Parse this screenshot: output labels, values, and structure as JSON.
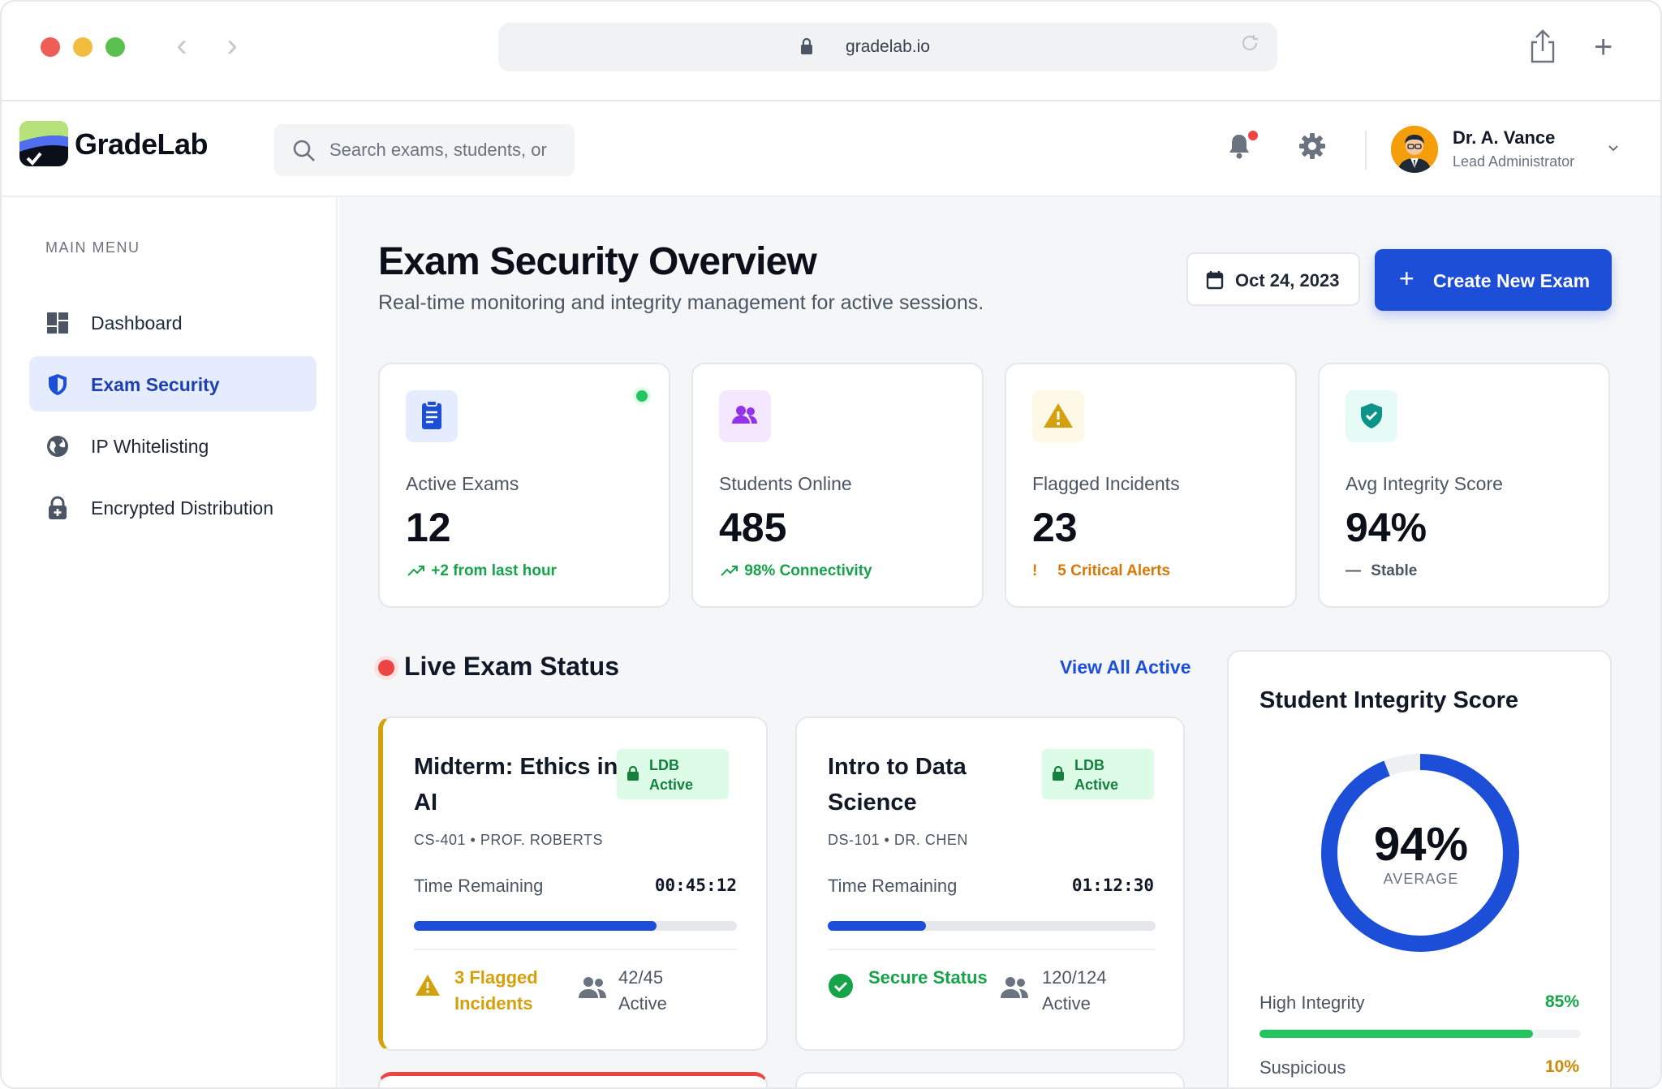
{
  "browser": {
    "url": "gradelab.io"
  },
  "header": {
    "brand": "GradeLab",
    "search_placeholder": "Search exams, students, or",
    "user_name": "Dr. A. Vance",
    "user_role": "Lead Administrator"
  },
  "sidebar": {
    "section_label": "MAIN MENU",
    "items": [
      {
        "label": "Dashboard",
        "icon": "dashboard-icon",
        "active": false
      },
      {
        "label": "Exam Security",
        "icon": "shield-icon",
        "active": true
      },
      {
        "label": "IP Whitelisting",
        "icon": "globe-icon",
        "active": false
      },
      {
        "label": "Encrypted Distribution",
        "icon": "lock-plus-icon",
        "active": false
      }
    ]
  },
  "main": {
    "title": "Exam Security Overview",
    "subtitle": "Real-time monitoring and integrity management for active sessions.",
    "date": "Oct 24, 2023",
    "create_label": "Create New Exam"
  },
  "stats": [
    {
      "label": "Active Exams",
      "value": "12",
      "trend": "+2 from last hour",
      "trend_color": "#16a34a",
      "icon": "clipboard-icon",
      "icon_color": "#1d4ed8",
      "icon_bg": "#e5ecfd"
    },
    {
      "label": "Students Online",
      "value": "485",
      "trend": "98% Connectivity",
      "trend_color": "#16a34a",
      "icon": "users-icon",
      "icon_color": "#9333ea",
      "icon_bg": "#f3e8ff"
    },
    {
      "label": "Flagged Incidents",
      "value": "23",
      "trend": "5 Critical Alerts",
      "trend_color": "#d97706",
      "icon": "warning-icon",
      "icon_color": "#d4a10e",
      "icon_bg": "#fef9e7"
    },
    {
      "label": "Avg Integrity Score",
      "value": "94%",
      "trend": "Stable",
      "trend_color": "#4b5563",
      "icon": "shield-check-icon",
      "icon_color": "#0d9488",
      "icon_bg": "#e6faf6"
    }
  ],
  "live": {
    "title": "Live Exam Status",
    "view_all": "View All Active"
  },
  "exams": [
    {
      "title": "Midterm: Ethics in AI",
      "badge": "LDB Active",
      "meta": "CS-401 • PROF. ROBERTS",
      "time_label": "Time Remaining",
      "time_value": "00:45:12",
      "progress": 0.75,
      "status": "3 Flagged Incidents",
      "status_color": "#d4a10e",
      "status_icon": "warning-icon",
      "active": "42/45 Active"
    },
    {
      "title": "Intro to Data Science",
      "badge": "LDB Active",
      "meta": "DS-101 • DR. CHEN",
      "time_label": "Time Remaining",
      "time_value": "01:12:30",
      "progress": 0.3,
      "status": "Secure Status",
      "status_color": "#16a34a",
      "status_icon": "check-circle-icon",
      "active": "120/124 Active"
    }
  ],
  "integrity": {
    "title": "Student Integrity Score",
    "score": "94%",
    "score_fraction": 0.94,
    "score_label": "AVERAGE",
    "rows": [
      {
        "label": "High Integrity",
        "pct": "85%",
        "fraction": 0.85,
        "color": "#22c55e",
        "pct_color": "#16a34a"
      },
      {
        "label": "Suspicious",
        "pct": "10%",
        "fraction": 0.1,
        "color": "#eab308",
        "pct_color": "#ca8a04"
      }
    ]
  }
}
